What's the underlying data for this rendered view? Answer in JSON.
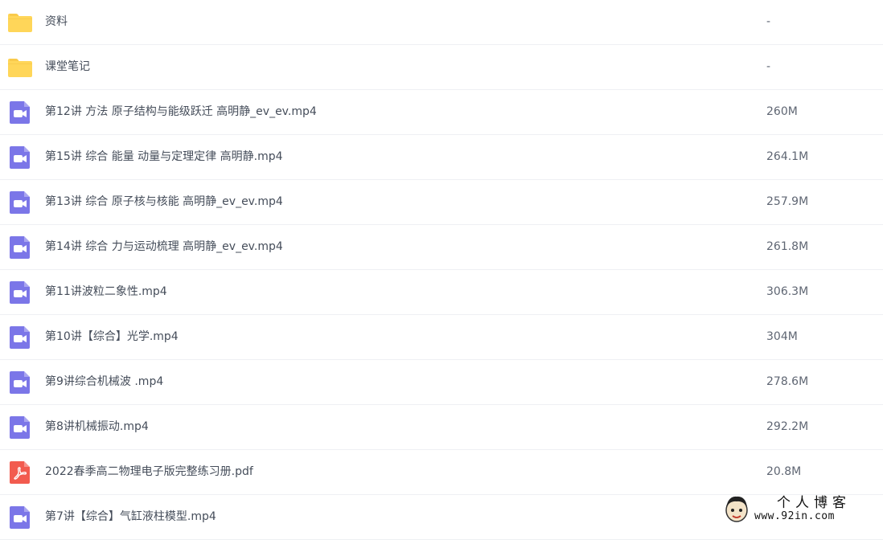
{
  "files": [
    {
      "type": "folder",
      "icon": "folder-icon",
      "name": "资料",
      "size": "-"
    },
    {
      "type": "folder",
      "icon": "folder-icon",
      "name": "课堂笔记",
      "size": "-"
    },
    {
      "type": "video",
      "icon": "video-file-icon",
      "name": "第12讲 方法 原子结构与能级跃迁 高明静_ev_ev.mp4",
      "size": "260M"
    },
    {
      "type": "video",
      "icon": "video-file-icon",
      "name": "第15讲 综合 能量 动量与定理定律 高明静.mp4",
      "size": "264.1M"
    },
    {
      "type": "video",
      "icon": "video-file-icon",
      "name": "第13讲 综合 原子核与核能 高明静_ev_ev.mp4",
      "size": "257.9M"
    },
    {
      "type": "video",
      "icon": "video-file-icon",
      "name": "第14讲 综合 力与运动梳理 高明静_ev_ev.mp4",
      "size": "261.8M"
    },
    {
      "type": "video",
      "icon": "video-file-icon",
      "name": "第11讲波粒二象性.mp4",
      "size": "306.3M"
    },
    {
      "type": "video",
      "icon": "video-file-icon",
      "name": "第10讲【综合】光学.mp4",
      "size": "304M"
    },
    {
      "type": "video",
      "icon": "video-file-icon",
      "name": "第9讲综合机械波 .mp4",
      "size": "278.6M"
    },
    {
      "type": "video",
      "icon": "video-file-icon",
      "name": "第8讲机械振动.mp4",
      "size": "292.2M"
    },
    {
      "type": "pdf",
      "icon": "pdf-file-icon",
      "name": "2022春季高二物理电子版完整练习册.pdf",
      "size": "20.8M"
    },
    {
      "type": "video",
      "icon": "video-file-icon",
      "name": "第7讲【综合】气缸液柱模型.mp4",
      "size": ""
    }
  ],
  "colors": {
    "folder": "#ffd659",
    "folder_tab": "#f5c242",
    "video": "#7b76e8",
    "pdf": "#f25b4f",
    "text": "#454d5a",
    "divider": "#eef0f3"
  },
  "watermark": {
    "title": "个人博客",
    "url": "www.92in.com"
  }
}
